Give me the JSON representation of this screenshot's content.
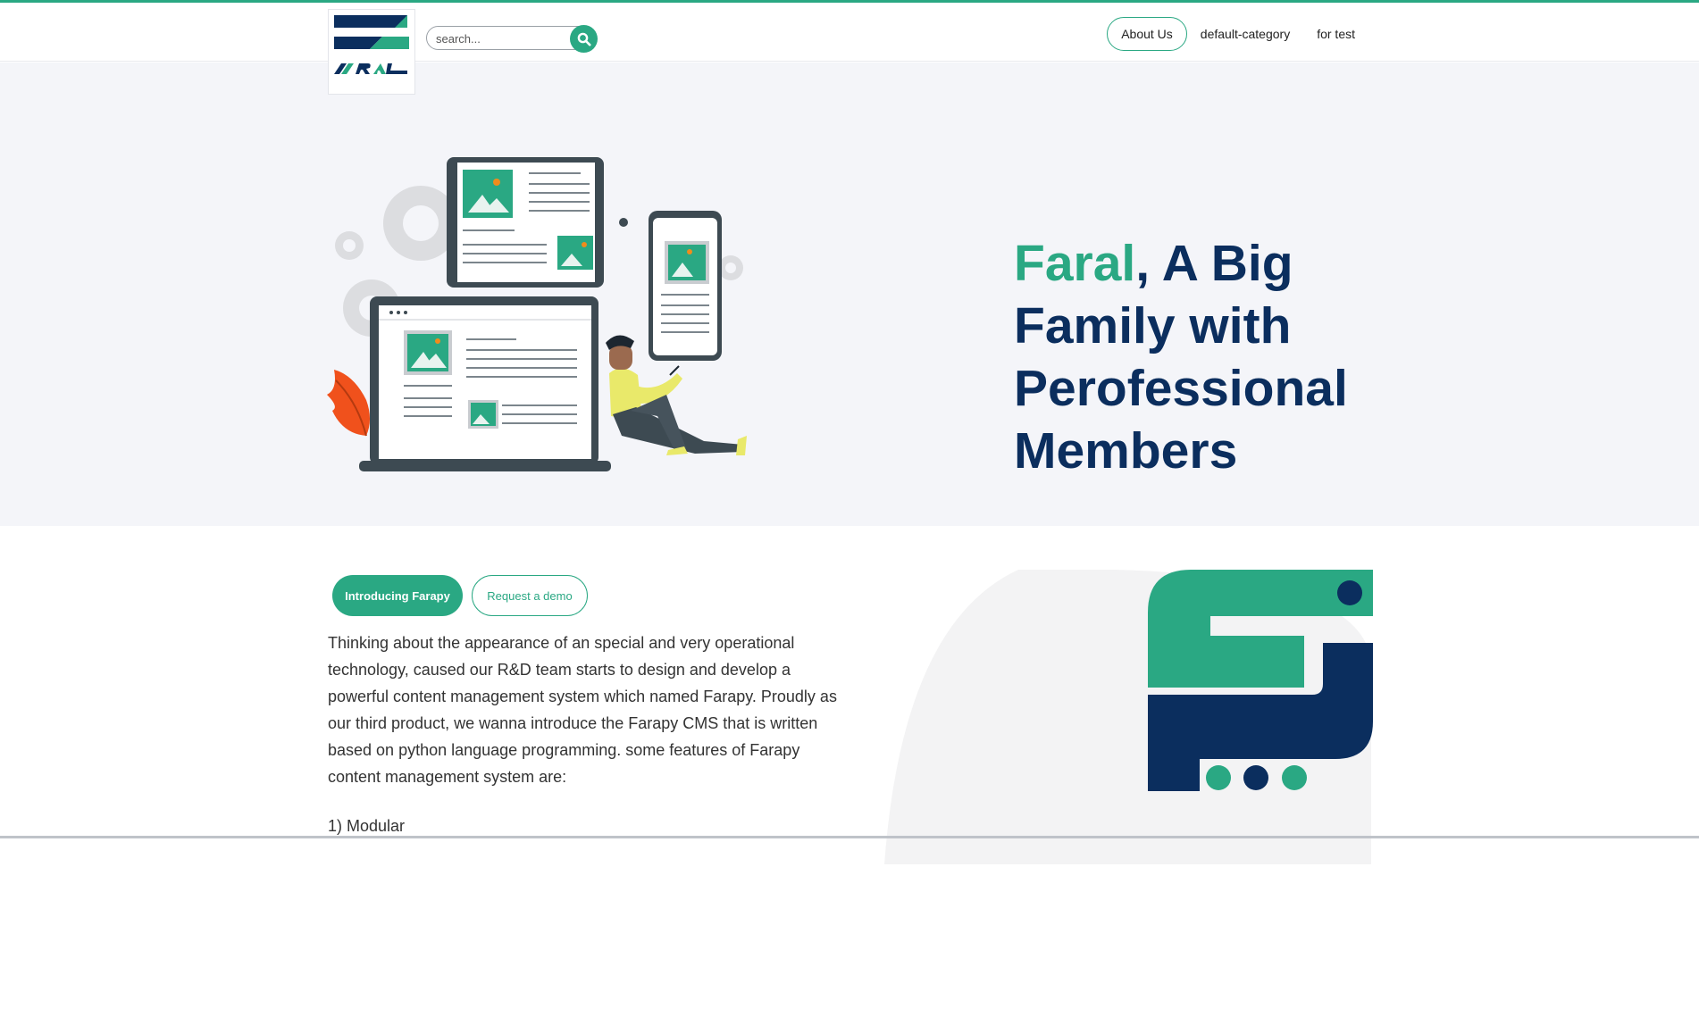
{
  "brand": {
    "logo_alt": "FARAL",
    "accent_color": "#2aa883",
    "navy_color": "#0b2e5e"
  },
  "search": {
    "placeholder": "search...",
    "icon": "search-icon"
  },
  "nav": {
    "items": [
      {
        "label": "About Us"
      },
      {
        "label": "default-category"
      },
      {
        "label": "for test"
      }
    ]
  },
  "hero": {
    "title_accent": "Faral",
    "title_rest": ", A Big Family with Perofessional Members"
  },
  "intro": {
    "primary_button": "Introducing Farapy",
    "secondary_button": "Request a demo",
    "paragraph": "Thinking about the appearance of an special and very operational technology, caused our R&D team starts to design and develop a powerful content management system which named Farapy. Proudly as our third product, we wanna introduce the Farapy CMS that is written based on python language programming. some features of Farapy content management system are:",
    "feature_1": "1) Modular"
  }
}
